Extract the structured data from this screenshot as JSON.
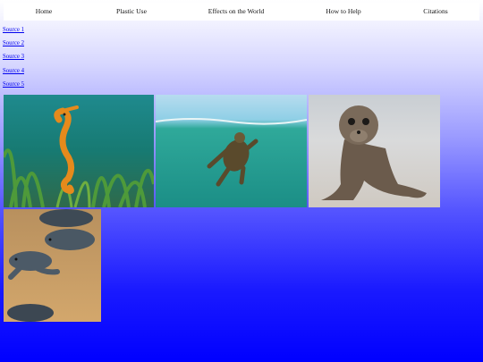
{
  "nav": {
    "items": [
      {
        "label": "Home"
      },
      {
        "label": "Plastic Use"
      },
      {
        "label": "Effects on the World"
      },
      {
        "label": "How to Help"
      },
      {
        "label": "Citations"
      }
    ]
  },
  "sources": {
    "links": [
      {
        "label": "Source 1"
      },
      {
        "label": "Source 2"
      },
      {
        "label": "Source 3"
      },
      {
        "label": "Source 4"
      },
      {
        "label": "Source 5"
      }
    ]
  },
  "gallery": {
    "images": [
      {
        "subject": "seahorse"
      },
      {
        "subject": "swimming-turtle"
      },
      {
        "subject": "sea-lion-pup"
      },
      {
        "subject": "baby-sea-turtles"
      }
    ]
  }
}
